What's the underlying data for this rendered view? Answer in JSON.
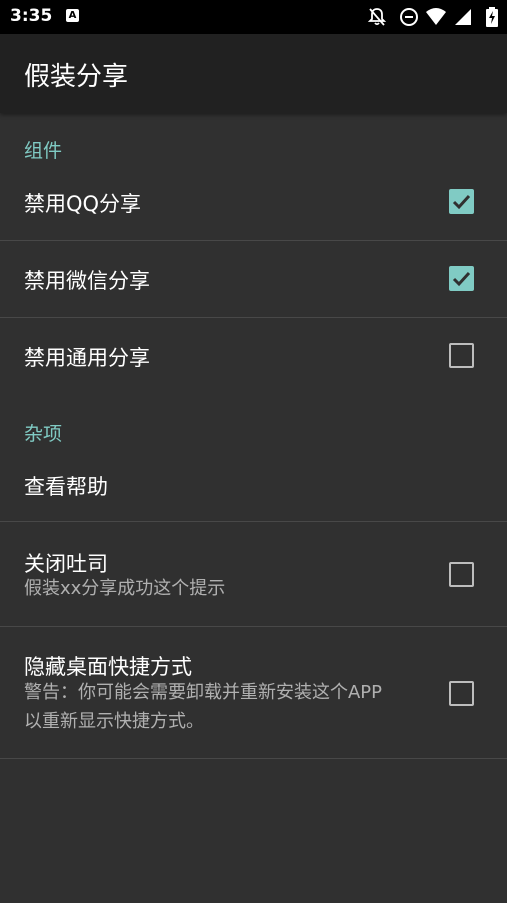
{
  "status_bar": {
    "time": "3:35",
    "notification_icon": "a-icon",
    "icons": [
      "notifications-off-icon",
      "do-not-disturb-icon",
      "wifi-icon",
      "cellular-signal-icon",
      "battery-charging-icon"
    ]
  },
  "toolbar": {
    "title": "假装分享"
  },
  "sections": {
    "components": {
      "header": "组件",
      "items": [
        {
          "title": "禁用QQ分享",
          "checked": true
        },
        {
          "title": "禁用微信分享",
          "checked": true
        },
        {
          "title": "禁用通用分享",
          "checked": false
        }
      ]
    },
    "misc": {
      "header": "杂项",
      "items": [
        {
          "title": "查看帮助"
        },
        {
          "title": "关闭吐司",
          "summary": "假装xx分享成功这个提示",
          "checked": false
        },
        {
          "title": "隐藏桌面快捷方式",
          "summary_line1": "警告：你可能会需要卸载并重新安装这个APP",
          "summary_line2": "以重新显示快捷方式。",
          "checked": false
        }
      ]
    }
  },
  "colors": {
    "accent": "#80cbc4",
    "background": "#303030",
    "toolbar": "#212121",
    "status_bar": "#000000"
  }
}
